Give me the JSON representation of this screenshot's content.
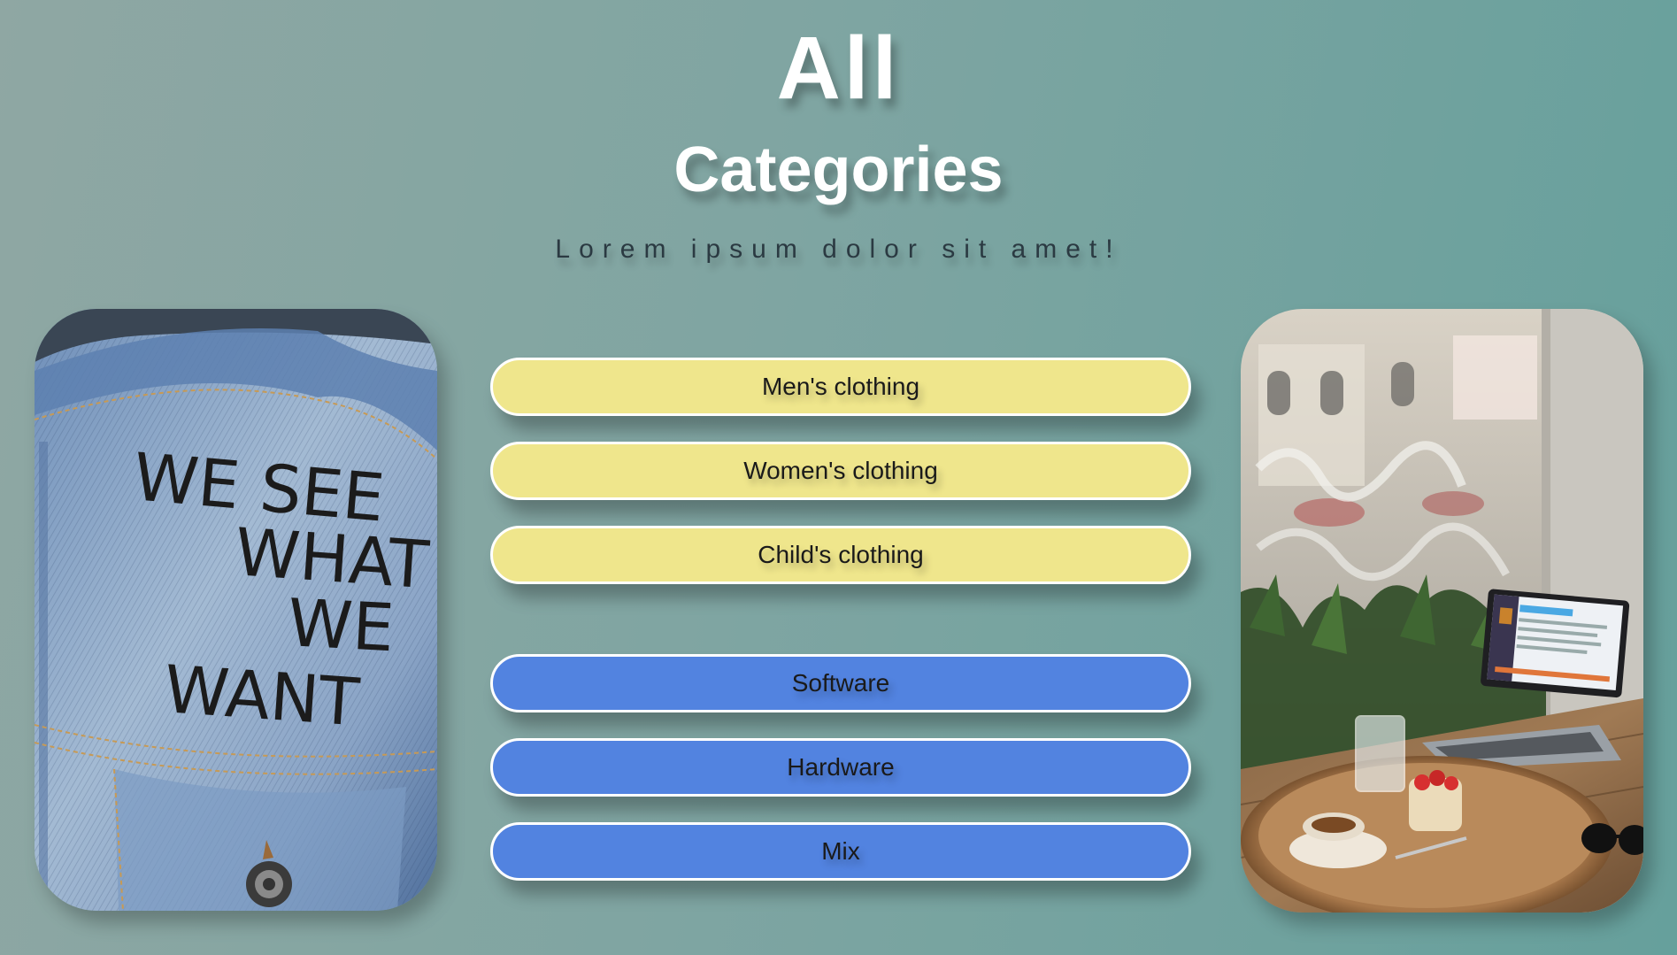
{
  "header": {
    "title_line1": "All",
    "title_line2": "Categories",
    "subtitle": "Lorem ipsum dolor sit amet!"
  },
  "photos": {
    "left": {
      "text_lines": [
        "WE SEE",
        "WHAT",
        "WE",
        "WANT"
      ],
      "subject": "denim-jacket-photo"
    },
    "right": {
      "subject": "cafe-laptop-photo"
    }
  },
  "categories": {
    "clothing": [
      {
        "label": "Men's clothing"
      },
      {
        "label": "Women's clothing"
      },
      {
        "label": "Child's clothing"
      }
    ],
    "tech": [
      {
        "label": "Software"
      },
      {
        "label": "Hardware"
      },
      {
        "label": "Mix"
      }
    ]
  },
  "colors": {
    "clothing_button": "#efe68c",
    "tech_button": "#5283e0",
    "title": "#ffffff"
  }
}
